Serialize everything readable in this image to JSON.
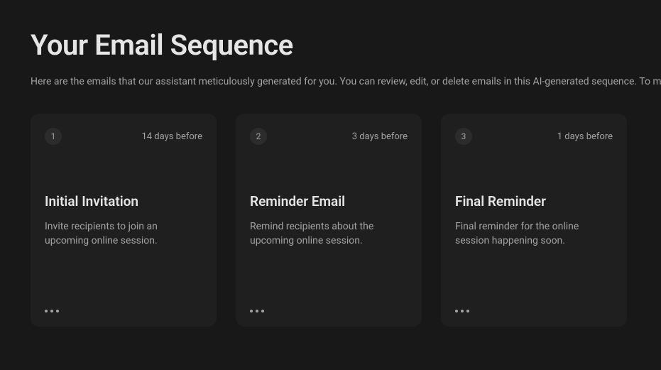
{
  "header": {
    "title": "Your Email Sequence",
    "description": "Here are the emails that our assistant meticulously generated for you. You can review, edit, or delete emails in this AI-generated sequence. To modify the entire concept, use the AI Assistant (the button at the bottom right)."
  },
  "cards": [
    {
      "number": "1",
      "timing": "14 days before",
      "title": "Initial Invitation",
      "description": "Invite recipients to join an upcoming online session."
    },
    {
      "number": "2",
      "timing": "3 days before",
      "title": "Reminder Email",
      "description": "Remind recipients about the upcoming online session."
    },
    {
      "number": "3",
      "timing": "1 days before",
      "title": "Final Reminder",
      "description": "Final reminder for the online session happening soon."
    }
  ]
}
